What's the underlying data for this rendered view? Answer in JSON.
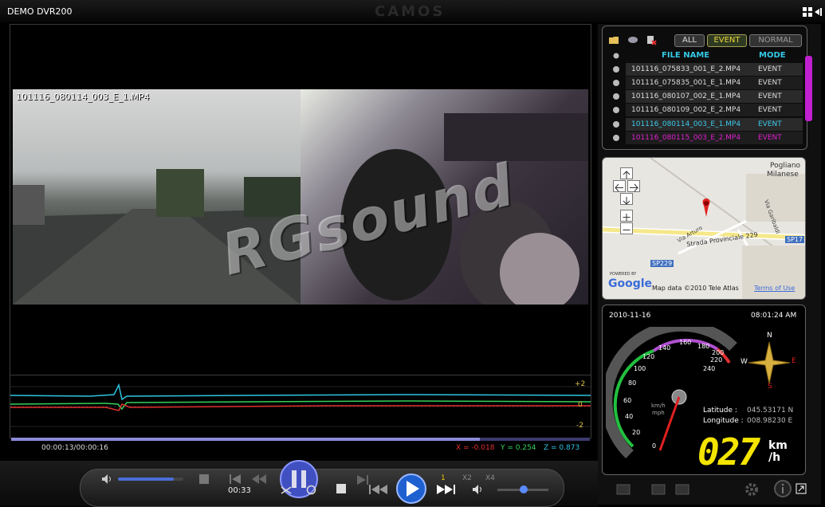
{
  "window": {
    "title": "DEMO DVR200",
    "brand": "CAMOS"
  },
  "video": {
    "clip_label": "101116_080114_003_E_1.MP4",
    "watermark": "RGsound"
  },
  "graph": {
    "plus_label": "+2",
    "zero_label": "0",
    "minus_label": "-2"
  },
  "status": {
    "timecode": "00:00:13/00:00:16",
    "x_text": "X = -0.018",
    "y_text": "Y = 0.254",
    "z_text": "Z = 0.873",
    "progress": 0.81
  },
  "controls": {
    "time_display": "00:33",
    "speed_1": "1",
    "speed_2": "X2",
    "speed_4": "X4",
    "volume": 0.85
  },
  "file_list": {
    "tabs": [
      {
        "label": "ALL"
      },
      {
        "label": "EVENT"
      },
      {
        "label": "NORMAL"
      }
    ],
    "header_name": "FILE NAME",
    "header_mode": "MODE",
    "rows": [
      {
        "name": "101116_075833_001_E_2.MP4",
        "mode": "EVENT"
      },
      {
        "name": "101116_075835_001_E_1.MP4",
        "mode": "EVENT"
      },
      {
        "name": "101116_080107_002_E_1.MP4",
        "mode": "EVENT"
      },
      {
        "name": "101116_080109_002_E_2.MP4",
        "mode": "EVENT"
      },
      {
        "name": "101116_080114_003_E_1.MP4",
        "mode": "EVENT"
      },
      {
        "name": "101116_080115_003_E_2.MP4",
        "mode": "EVENT"
      }
    ]
  },
  "map": {
    "town": "Pogliano",
    "town2": "Milanese",
    "road1": "Strada Provinciale 229",
    "road2": "Via Arturo",
    "road3": "Via Garibaldi",
    "road4": "SP229",
    "road5": "SP17",
    "powered": "POWERED BY",
    "google": "Google",
    "copyright": "Map data ©2010 Tele Atlas",
    "terms": "Terms of Use"
  },
  "speedo": {
    "date": "2010-11-16",
    "time": "08:01:24 AM",
    "lat_label": "Latitude :",
    "lat_value": "045.53171 N",
    "lon_label": "Longitude :",
    "lon_value": "008.98230 E",
    "speed": "027",
    "unit_km": "km",
    "unit_h": "/h",
    "gauge_unit_top": "km/h",
    "gauge_unit_bottom": "mph",
    "compass_n": "N",
    "compass_s": "S",
    "compass_e": "E",
    "compass_w": "W",
    "ticks": [
      "0",
      "20",
      "40",
      "60",
      "80",
      "100",
      "120",
      "140",
      "160",
      "180",
      "200",
      "220",
      "240"
    ]
  }
}
